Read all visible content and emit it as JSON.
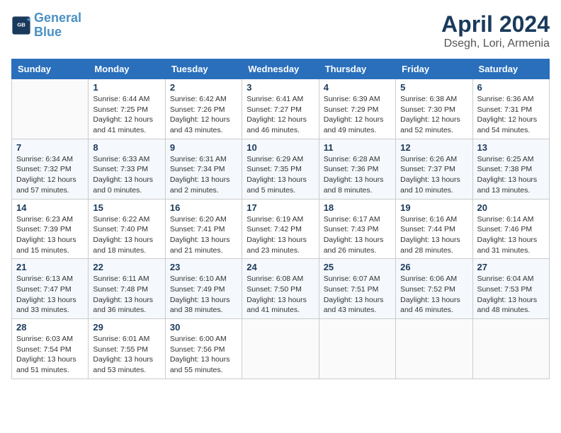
{
  "header": {
    "logo_line1": "General",
    "logo_line2": "Blue",
    "month_title": "April 2024",
    "location": "Dsegh, Lori, Armenia"
  },
  "columns": [
    "Sunday",
    "Monday",
    "Tuesday",
    "Wednesday",
    "Thursday",
    "Friday",
    "Saturday"
  ],
  "weeks": [
    [
      {
        "day": "",
        "info": ""
      },
      {
        "day": "1",
        "info": "Sunrise: 6:44 AM\nSunset: 7:25 PM\nDaylight: 12 hours\nand 41 minutes."
      },
      {
        "day": "2",
        "info": "Sunrise: 6:42 AM\nSunset: 7:26 PM\nDaylight: 12 hours\nand 43 minutes."
      },
      {
        "day": "3",
        "info": "Sunrise: 6:41 AM\nSunset: 7:27 PM\nDaylight: 12 hours\nand 46 minutes."
      },
      {
        "day": "4",
        "info": "Sunrise: 6:39 AM\nSunset: 7:29 PM\nDaylight: 12 hours\nand 49 minutes."
      },
      {
        "day": "5",
        "info": "Sunrise: 6:38 AM\nSunset: 7:30 PM\nDaylight: 12 hours\nand 52 minutes."
      },
      {
        "day": "6",
        "info": "Sunrise: 6:36 AM\nSunset: 7:31 PM\nDaylight: 12 hours\nand 54 minutes."
      }
    ],
    [
      {
        "day": "7",
        "info": "Sunrise: 6:34 AM\nSunset: 7:32 PM\nDaylight: 12 hours\nand 57 minutes."
      },
      {
        "day": "8",
        "info": "Sunrise: 6:33 AM\nSunset: 7:33 PM\nDaylight: 13 hours\nand 0 minutes."
      },
      {
        "day": "9",
        "info": "Sunrise: 6:31 AM\nSunset: 7:34 PM\nDaylight: 13 hours\nand 2 minutes."
      },
      {
        "day": "10",
        "info": "Sunrise: 6:29 AM\nSunset: 7:35 PM\nDaylight: 13 hours\nand 5 minutes."
      },
      {
        "day": "11",
        "info": "Sunrise: 6:28 AM\nSunset: 7:36 PM\nDaylight: 13 hours\nand 8 minutes."
      },
      {
        "day": "12",
        "info": "Sunrise: 6:26 AM\nSunset: 7:37 PM\nDaylight: 13 hours\nand 10 minutes."
      },
      {
        "day": "13",
        "info": "Sunrise: 6:25 AM\nSunset: 7:38 PM\nDaylight: 13 hours\nand 13 minutes."
      }
    ],
    [
      {
        "day": "14",
        "info": "Sunrise: 6:23 AM\nSunset: 7:39 PM\nDaylight: 13 hours\nand 15 minutes."
      },
      {
        "day": "15",
        "info": "Sunrise: 6:22 AM\nSunset: 7:40 PM\nDaylight: 13 hours\nand 18 minutes."
      },
      {
        "day": "16",
        "info": "Sunrise: 6:20 AM\nSunset: 7:41 PM\nDaylight: 13 hours\nand 21 minutes."
      },
      {
        "day": "17",
        "info": "Sunrise: 6:19 AM\nSunset: 7:42 PM\nDaylight: 13 hours\nand 23 minutes."
      },
      {
        "day": "18",
        "info": "Sunrise: 6:17 AM\nSunset: 7:43 PM\nDaylight: 13 hours\nand 26 minutes."
      },
      {
        "day": "19",
        "info": "Sunrise: 6:16 AM\nSunset: 7:44 PM\nDaylight: 13 hours\nand 28 minutes."
      },
      {
        "day": "20",
        "info": "Sunrise: 6:14 AM\nSunset: 7:46 PM\nDaylight: 13 hours\nand 31 minutes."
      }
    ],
    [
      {
        "day": "21",
        "info": "Sunrise: 6:13 AM\nSunset: 7:47 PM\nDaylight: 13 hours\nand 33 minutes."
      },
      {
        "day": "22",
        "info": "Sunrise: 6:11 AM\nSunset: 7:48 PM\nDaylight: 13 hours\nand 36 minutes."
      },
      {
        "day": "23",
        "info": "Sunrise: 6:10 AM\nSunset: 7:49 PM\nDaylight: 13 hours\nand 38 minutes."
      },
      {
        "day": "24",
        "info": "Sunrise: 6:08 AM\nSunset: 7:50 PM\nDaylight: 13 hours\nand 41 minutes."
      },
      {
        "day": "25",
        "info": "Sunrise: 6:07 AM\nSunset: 7:51 PM\nDaylight: 13 hours\nand 43 minutes."
      },
      {
        "day": "26",
        "info": "Sunrise: 6:06 AM\nSunset: 7:52 PM\nDaylight: 13 hours\nand 46 minutes."
      },
      {
        "day": "27",
        "info": "Sunrise: 6:04 AM\nSunset: 7:53 PM\nDaylight: 13 hours\nand 48 minutes."
      }
    ],
    [
      {
        "day": "28",
        "info": "Sunrise: 6:03 AM\nSunset: 7:54 PM\nDaylight: 13 hours\nand 51 minutes."
      },
      {
        "day": "29",
        "info": "Sunrise: 6:01 AM\nSunset: 7:55 PM\nDaylight: 13 hours\nand 53 minutes."
      },
      {
        "day": "30",
        "info": "Sunrise: 6:00 AM\nSunset: 7:56 PM\nDaylight: 13 hours\nand 55 minutes."
      },
      {
        "day": "",
        "info": ""
      },
      {
        "day": "",
        "info": ""
      },
      {
        "day": "",
        "info": ""
      },
      {
        "day": "",
        "info": ""
      }
    ]
  ]
}
